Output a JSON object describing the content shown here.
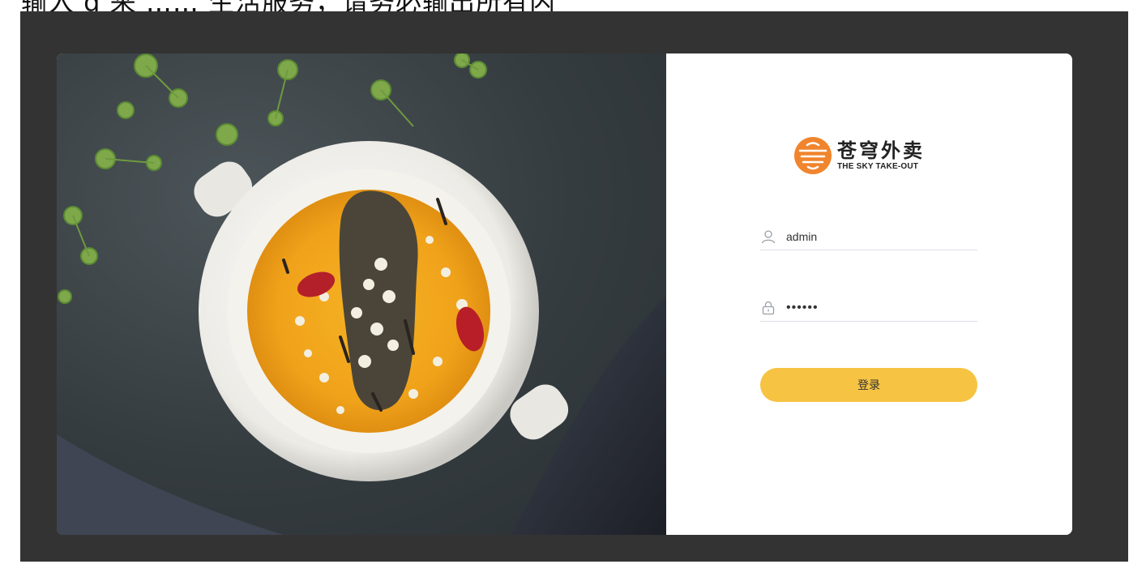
{
  "top_strip": {
    "text": "输入 g      来 …… 生活服务，请务必输出所有内"
  },
  "logo": {
    "name_cn": "苍穹外卖",
    "name_en": "THE SKY TAKE-OUT",
    "icon": "sky-takeout-logo-icon"
  },
  "login_form": {
    "username": {
      "value": "admin",
      "icon": "user-icon"
    },
    "password": {
      "value": "••••••",
      "icon": "lock-icon"
    },
    "submit_label": "登录"
  },
  "colors": {
    "stage_bg": "#333333",
    "button_bg": "#f6c343",
    "logo_orange": "#f0852e"
  }
}
